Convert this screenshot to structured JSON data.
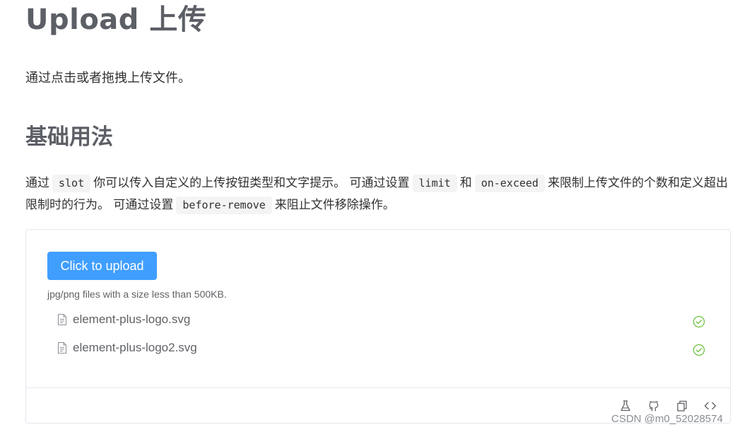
{
  "page": {
    "title": "Upload 上传",
    "description": "通过点击或者拖拽上传文件。"
  },
  "section": {
    "title": "基础用法",
    "desc_parts": {
      "p1": "通过",
      "c1": "slot",
      "p2": "你可以传入自定义的上传按钮类型和文字提示。 可通过设置",
      "c2": "limit",
      "p3": "和",
      "c3": "on-exceed",
      "p4": "来限制上传文件的个数和定义超出限制时的行为。 可通过设置",
      "c4": "before-remove",
      "p5": "来阻止文件移除操作。"
    }
  },
  "demo": {
    "upload_button_label": "Click to upload",
    "tip": "jpg/png files with a size less than 500KB.",
    "files": [
      {
        "name": "element-plus-logo.svg",
        "status": "success"
      },
      {
        "name": "element-plus-logo2.svg",
        "status": "success"
      }
    ],
    "toolbar_icons": [
      "playground-flask-icon",
      "github-icon",
      "copy-icon",
      "code-icon"
    ]
  },
  "watermark": "CSDN @m0_52028574",
  "colors": {
    "primary": "#409eff",
    "success": "#67c23a",
    "heading": "#5c5f66",
    "text": "#303133",
    "muted": "#606266",
    "border": "#e4e7ed"
  }
}
